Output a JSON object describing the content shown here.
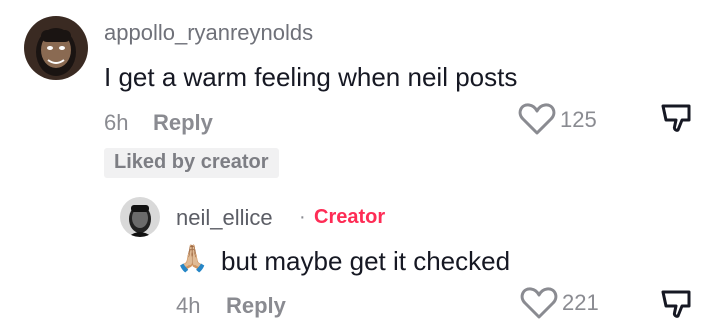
{
  "comment": {
    "username": "appollo_ryanreynolds",
    "text": "I get a warm feeling when neil posts",
    "time": "6h",
    "reply_label": "Reply",
    "like_count": "125",
    "liked_badge": "Liked by creator"
  },
  "reply": {
    "username": "neil_ellice",
    "separator": "·",
    "creator_label": "Creator",
    "emoji": "🙏🏼",
    "text": "but maybe get it checked",
    "time": "4h",
    "reply_label": "Reply",
    "like_count": "221"
  },
  "colors": {
    "creator": "#fe2c55",
    "text": "#161823",
    "muted": "#8a8b91"
  },
  "icons": {
    "like": "heart-outline-icon",
    "dislike": "thumbs-down-icon"
  }
}
